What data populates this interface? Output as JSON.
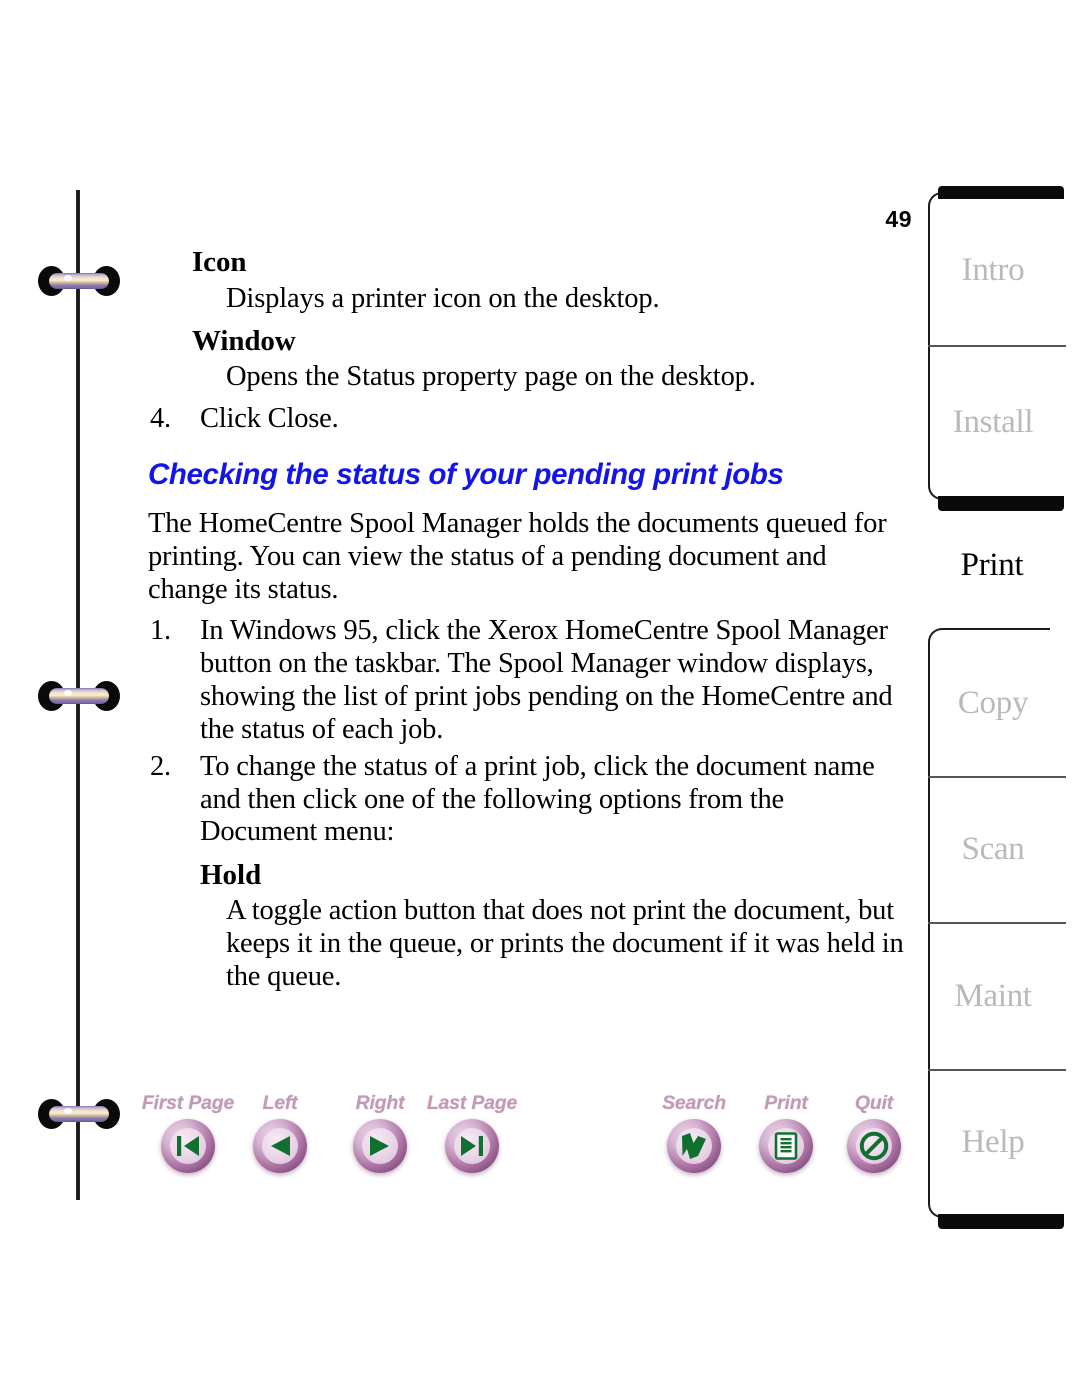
{
  "document": {
    "page_number": "49"
  },
  "content": {
    "terms": [
      {
        "term": "Icon",
        "definition": "Displays a printer icon on the desktop."
      },
      {
        "term": "Window",
        "definition": "Opens the Status property page on the desktop."
      }
    ],
    "step4": {
      "num": "4.",
      "text": "Click Close."
    },
    "section_heading": "Checking the status of your pending print jobs",
    "intro_paragraph": "The HomeCentre Spool Manager holds the documents queued for printing. You can view the status of a pending document and change its status.",
    "steps": [
      {
        "num": "1.",
        "text": "In Windows 95, click the Xerox HomeCentre Spool Manager button on the taskbar. The Spool Manager window displays, showing the list of print jobs pending on the HomeCentre and the status of each job."
      },
      {
        "num": "2.",
        "text": "To change the status of a print job, click the document name and then click one of the following options from the Document menu:"
      }
    ],
    "hold": {
      "term": "Hold",
      "definition": "A toggle action button that does not print the document, but keeps it in the queue, or prints the document if it was held in the queue."
    }
  },
  "toolbar": {
    "buttons": [
      {
        "label": "First Page",
        "icon": "first-page-icon"
      },
      {
        "label": "Left",
        "icon": "previous-page-icon"
      },
      {
        "label": "Right",
        "icon": "next-page-icon"
      },
      {
        "label": "Last Page",
        "icon": "last-page-icon"
      },
      {
        "label": "Search",
        "icon": "search-icon"
      },
      {
        "label": "Print",
        "icon": "print-icon"
      },
      {
        "label": "Quit",
        "icon": "quit-icon"
      }
    ]
  },
  "rail": {
    "group1": [
      {
        "label": "Intro"
      },
      {
        "label": "Install"
      }
    ],
    "active_tab": {
      "label": "Print"
    },
    "group2": [
      {
        "label": "Copy"
      },
      {
        "label": "Scan"
      },
      {
        "label": "Maint"
      },
      {
        "label": "Help"
      }
    ]
  },
  "colors": {
    "heading_blue": "#1414e8",
    "tab_inactive": "#b9b9b9",
    "tab_active": "#000000",
    "toolbar_label": "#c09ab6",
    "button_glyph_green": "#11702f"
  }
}
